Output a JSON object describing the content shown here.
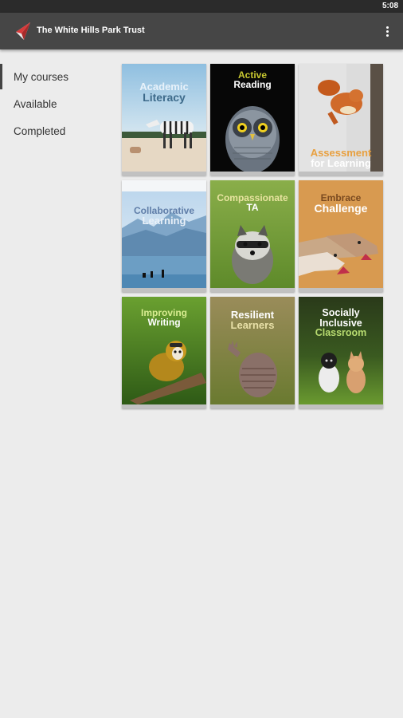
{
  "status_bar": {
    "time": "5:08"
  },
  "app_bar": {
    "title": "The White Hills Park Trust",
    "logo_icon": "paper-plane-logo-icon",
    "menu_icon": "more-vert-icon"
  },
  "nav": {
    "items": [
      {
        "label": "My courses",
        "active": true
      },
      {
        "label": "Available",
        "active": false
      },
      {
        "label": "Completed",
        "active": false
      }
    ]
  },
  "courses": [
    {
      "line1": "Academic",
      "line2": "Literacy",
      "image": "zebra"
    },
    {
      "line1": "Active",
      "line2": "Reading",
      "image": "owl"
    },
    {
      "line1": "Assessment",
      "line2": "for Learning",
      "image": "squirrel"
    },
    {
      "line1": "Collaborative",
      "line2": "Learning",
      "image": "mountain-lake"
    },
    {
      "line1": "Compassionate",
      "line2": "TA",
      "image": "raccoon"
    },
    {
      "line1": "Embrace",
      "line2": "Challenge",
      "image": "greyhounds"
    },
    {
      "line1": "Improving",
      "line2": "Writing",
      "image": "monkey"
    },
    {
      "line1": "Resilient",
      "line2": "Learners",
      "image": "armadillo"
    },
    {
      "line1": "Socially",
      "line2": "Inclusive",
      "line3": "Classroom",
      "image": "kitten-puppy"
    }
  ]
}
